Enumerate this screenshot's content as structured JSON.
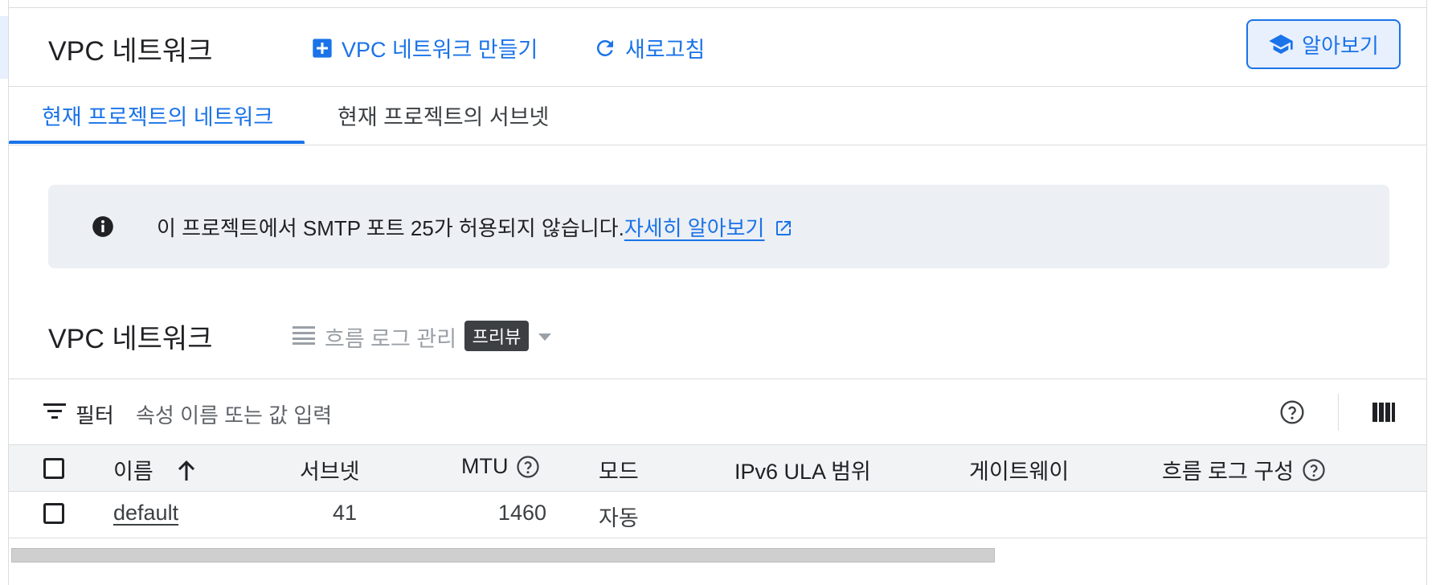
{
  "header": {
    "title": "VPC 네트워크",
    "create_label": "VPC 네트워크 만들기",
    "refresh_label": "새로고침",
    "learn_label": "알아보기"
  },
  "tabs": [
    {
      "label": "현재 프로젝트의 네트워크",
      "active": true
    },
    {
      "label": "현재 프로젝트의 서브넷",
      "active": false
    }
  ],
  "banner": {
    "icon": "info-icon",
    "text": "이 프로젝트에서 SMTP 포트 25가 허용되지 않습니다.",
    "link": "자세히 알아보기"
  },
  "section": {
    "title": "VPC 네트워크",
    "flow_logs_label": "흐름 로그 관리",
    "preview_badge": "프리뷰"
  },
  "filter": {
    "label": "필터",
    "placeholder": "속성 이름 또는 값 입력"
  },
  "table": {
    "columns": [
      "이름",
      "서브넷",
      "MTU",
      "모드",
      "IPv6 ULA 범위",
      "게이트웨이",
      "흐름 로그 구성"
    ],
    "rows": [
      {
        "name": "default",
        "subnets": "41",
        "mtu": "1460",
        "mode": "자동",
        "ipv6": "",
        "gateway": "",
        "flow_logs": ""
      }
    ]
  },
  "colors": {
    "accent": "#1a73e8",
    "banner_bg": "#eceff4",
    "header_bg": "#f1f3f4",
    "badge_bg": "#3c4043"
  }
}
